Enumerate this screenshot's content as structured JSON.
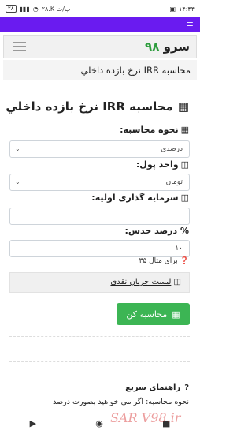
{
  "status": {
    "left_text": "۲۸.K ب/ث",
    "battery": "۲۸",
    "time": "۱۴:۴۴"
  },
  "nav": {
    "brand_name": "سرو",
    "brand_number": "۹۸"
  },
  "breadcrumb": "محاسبه IRR نرخ بازده داخلي",
  "heading": "محاسبه IRR نرخ بازده داخلي",
  "form": {
    "method_label": "نحوه محاسبه:",
    "method_value": "درصدی",
    "unit_label": "واحد پول:",
    "unit_value": "تومان",
    "invest_label": "سرمایه گذاری اولیه:",
    "invest_value": "",
    "guess_label": "% درصد حدس:",
    "guess_value": "۱۰",
    "hint": "برای مثال ۳۵"
  },
  "cashflow_label": "لیست جریان نقدی",
  "calc_button": "محاسبه کن",
  "quick_guide": {
    "title": "راهنمای سریع",
    "text": "نحوه محاسبه: اگر می خواهید بصورت درصد"
  },
  "watermark": "SAR V98.ir",
  "nav_buttons": [
    "▶",
    "◉",
    "■"
  ]
}
